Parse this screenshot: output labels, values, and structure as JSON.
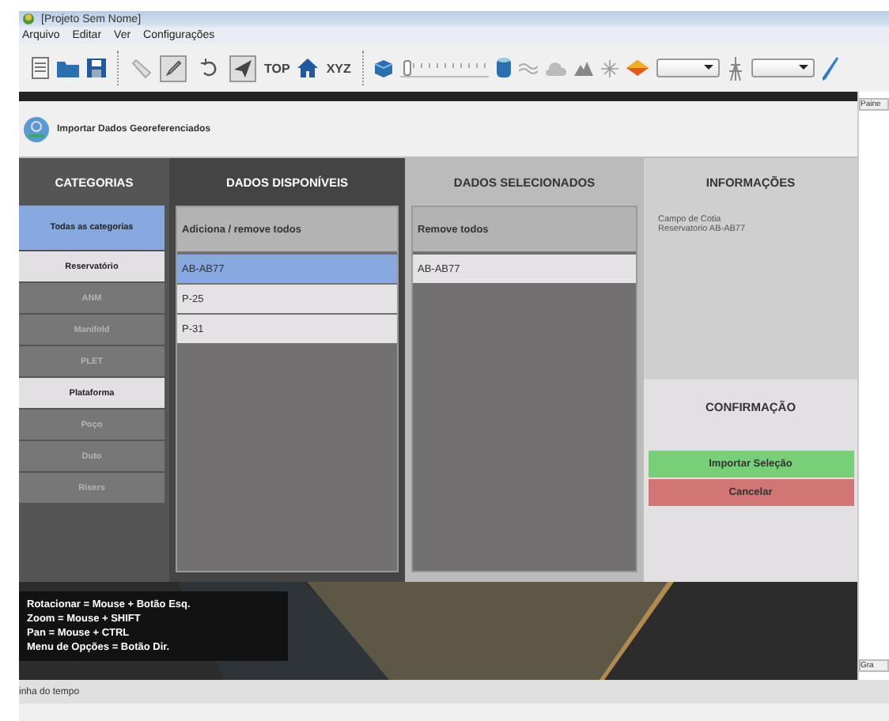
{
  "window": {
    "title": "[Projeto Sem Nome]"
  },
  "menu": [
    "Arquivo",
    "Editar",
    "Ver",
    "Configurações"
  ],
  "toolbar": {
    "top_label": "TOP",
    "xyz_label": "XYZ",
    "slider": {
      "level": 0.03
    },
    "tools": [
      {
        "kind": "pen",
        "selected": true
      },
      {
        "kind": "rotate",
        "selected": false
      },
      {
        "kind": "plane",
        "selected": true
      }
    ]
  },
  "right_panel": {
    "top_tab": "Paine",
    "bottom_tab": "Gra"
  },
  "dialog": {
    "title": "Importar Dados Georeferenciados",
    "categories": {
      "heading": "CATEGORIAS",
      "items": [
        {
          "label": "Todas as categorias",
          "selected": true,
          "disabled": false
        },
        {
          "label": "Reservatório",
          "selected": false,
          "disabled": false
        },
        {
          "label": "ANM",
          "selected": false,
          "disabled": true
        },
        {
          "label": "Manifold",
          "selected": false,
          "disabled": true
        },
        {
          "label": "PLET",
          "selected": false,
          "disabled": true
        },
        {
          "label": "Plataforma",
          "selected": false,
          "disabled": false
        },
        {
          "label": "Poço",
          "selected": false,
          "disabled": true
        },
        {
          "label": "Duto",
          "selected": false,
          "disabled": true
        },
        {
          "label": "Risers",
          "selected": false,
          "disabled": true
        }
      ]
    },
    "available": {
      "heading": "DADOS DISPONÍVEIS",
      "list_header": "Adiciona / remove todos",
      "items": [
        {
          "label": "AB-AB77",
          "selected": true
        },
        {
          "label": "P-25",
          "selected": false
        },
        {
          "label": "P-31",
          "selected": false
        }
      ]
    },
    "selected_data": {
      "heading": "DADOS SELECIONADOS",
      "list_header": "Remove todos",
      "items": [
        {
          "label": "AB-AB77",
          "selected": false
        }
      ]
    },
    "info": {
      "heading": "INFORMAÇÕES",
      "lines": [
        "Campo de Cotia",
        "Reservatorio AB-AB77"
      ]
    },
    "confirmation": {
      "heading": "CONFIRMAÇÃO",
      "buttons": [
        {
          "label": "Importar Seleção",
          "kind": "confirm"
        },
        {
          "label": "Cancelar",
          "kind": "cancel"
        }
      ]
    }
  },
  "help_lines": [
    "Rotacionar = Mouse + Botão Esq.",
    "Zoom = Mouse + SHIFT",
    "Pan = Mouse + CTRL",
    "Menu de Opções = Botão Dir."
  ],
  "status_bar": {
    "label": "inha do tempo"
  }
}
